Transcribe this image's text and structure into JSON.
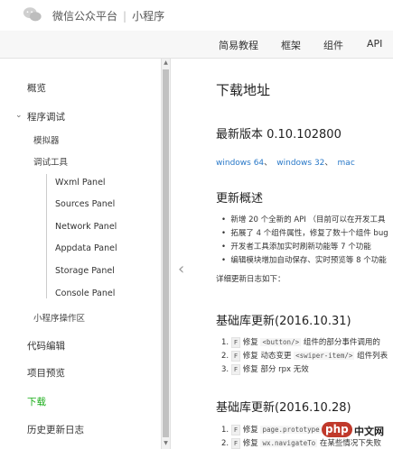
{
  "header": {
    "brand": "微信公众平台",
    "separator": "|",
    "product": "小程序"
  },
  "topnav": {
    "items": [
      "简易教程",
      "框架",
      "组件",
      "API"
    ]
  },
  "sidebar": {
    "items": [
      {
        "label": "概览"
      },
      {
        "label": "程序调试"
      },
      {
        "label": "模拟器"
      },
      {
        "label": "调试工具"
      },
      {
        "label": "Wxml Panel"
      },
      {
        "label": "Sources Panel"
      },
      {
        "label": "Network Panel"
      },
      {
        "label": "Appdata Panel"
      },
      {
        "label": "Storage Panel"
      },
      {
        "label": "Console Panel"
      },
      {
        "label": "小程序操作区"
      },
      {
        "label": "代码编辑"
      },
      {
        "label": "项目预览"
      },
      {
        "label": "下载"
      },
      {
        "label": "历史更新日志"
      }
    ]
  },
  "content": {
    "title": "下载地址",
    "latest_heading": "最新版本 0.10.102800",
    "downloads": {
      "win64": "windows 64",
      "sep1": "、",
      "win32": "windows 32",
      "sep2": "、",
      "mac": "mac"
    },
    "overview_heading": "更新概述",
    "overview_items": [
      "新增 20 个全新的 API （目前可以在开发工具",
      "拓展了 4 个组件属性，修复了数十个组件 bug",
      "开发者工具添加实时刷新功能等 7 个功能",
      "编辑模块增加自动保存、实时预览等 8 个功能"
    ],
    "details": "详细更新日志如下：",
    "lib1": {
      "heading": "基础库更新(2016.10.31)",
      "items": [
        {
          "num": "1.",
          "tag": "F",
          "a": "修复",
          "code": "<button/>",
          "b": "组件的部分事件调用的"
        },
        {
          "num": "2.",
          "tag": "F",
          "a": "修复 动态变更",
          "code": "<swiper-item/>",
          "b": "组件列表"
        },
        {
          "num": "3.",
          "tag": "F",
          "a": "修复 部分 rpx 无效",
          "code": "",
          "b": ""
        }
      ]
    },
    "lib2": {
      "heading": "基础库更新(2016.10.28)",
      "items": [
        {
          "num": "1.",
          "tag": "F",
          "a": "修复",
          "code": "page.prototype",
          "b": ""
        },
        {
          "num": "2.",
          "tag": "F",
          "a": "修复",
          "code": "wx.navigateTo",
          "b": "在某些情况下失败"
        }
      ]
    }
  },
  "watermark": {
    "badge": "php",
    "text": "中文网"
  },
  "colors": {
    "accent": "#1aad19",
    "link": "#2878c8"
  }
}
